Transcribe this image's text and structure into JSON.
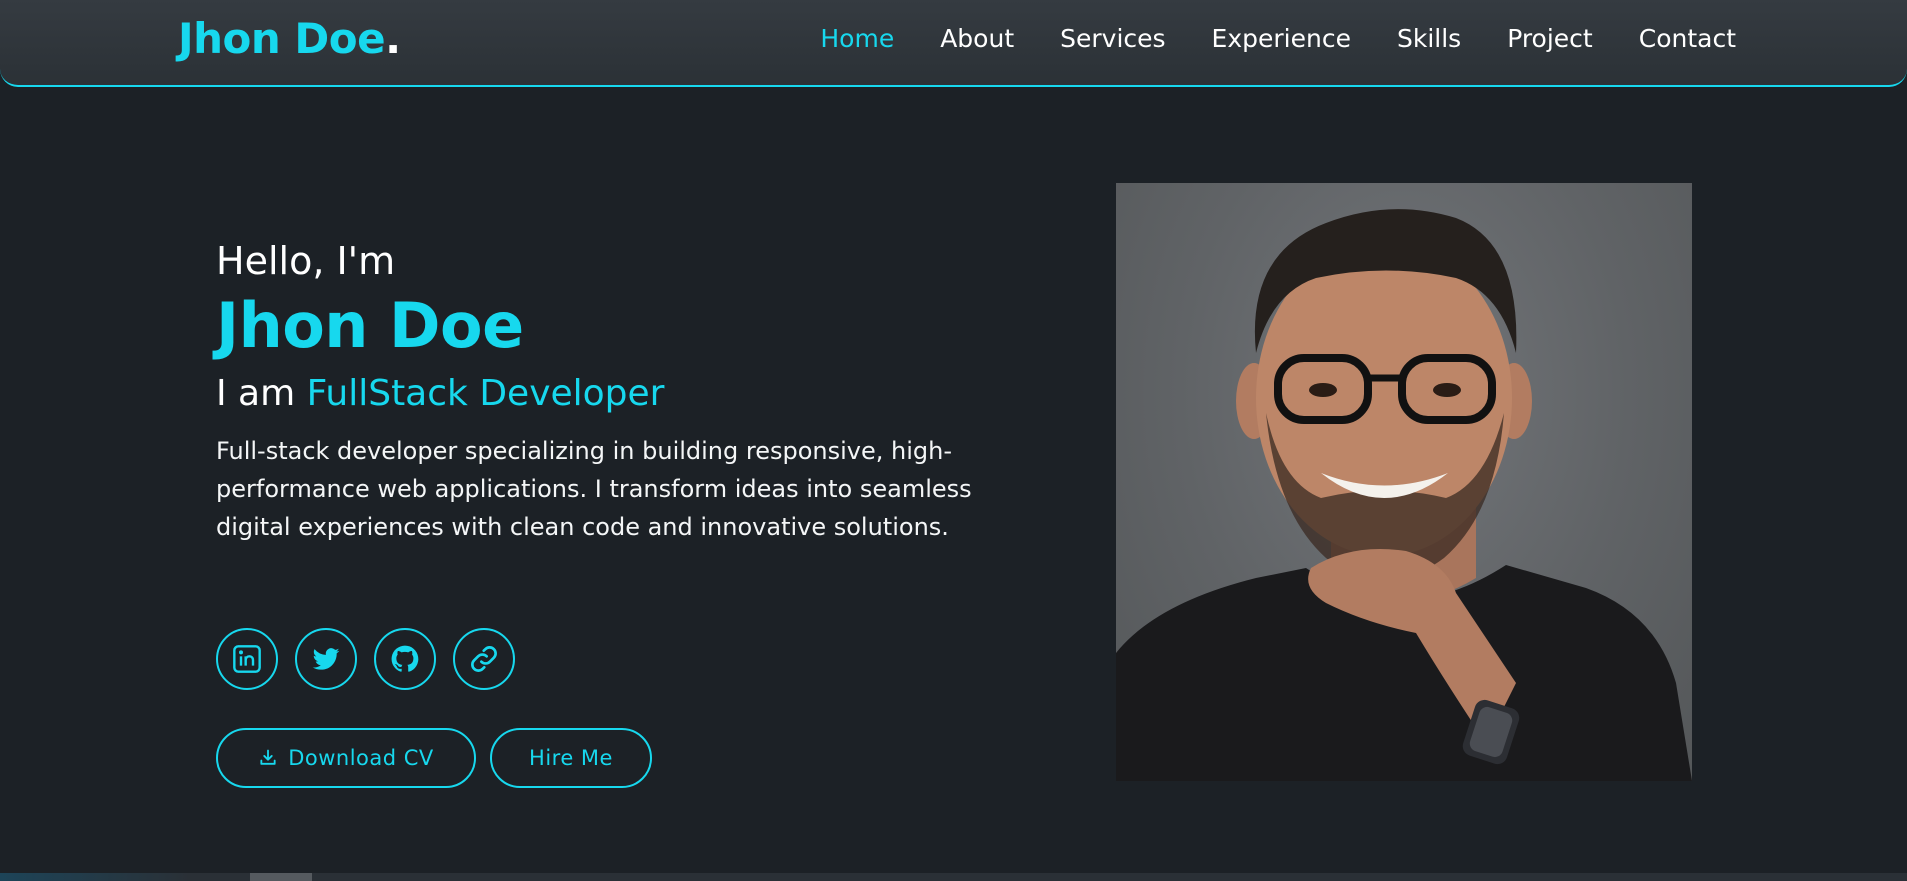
{
  "brand": {
    "name": "Jhon Doe",
    "dot": "."
  },
  "nav": {
    "items": [
      {
        "label": "Home",
        "active": true
      },
      {
        "label": "About"
      },
      {
        "label": "Services"
      },
      {
        "label": "Experience"
      },
      {
        "label": "Skills"
      },
      {
        "label": "Project"
      },
      {
        "label": "Contact"
      }
    ]
  },
  "hero": {
    "greeting": "Hello, I'm",
    "name": "Jhon Doe",
    "role_prefix": "I am",
    "role": "FullStack Developer",
    "description": "Full-stack developer specializing in building responsive, high-performance web applications. I transform ideas into seamless digital experiences with clean code and innovative solutions."
  },
  "socials": [
    {
      "icon": "linkedin-icon"
    },
    {
      "icon": "twitter-icon"
    },
    {
      "icon": "github-icon"
    },
    {
      "icon": "link-icon"
    }
  ],
  "buttons": {
    "download_cv": "Download CV",
    "hire_me": "Hire Me"
  },
  "colors": {
    "accent": "#17d8ee",
    "background": "#1c2126",
    "navbar": "#33393e",
    "text": "#ffffff"
  }
}
